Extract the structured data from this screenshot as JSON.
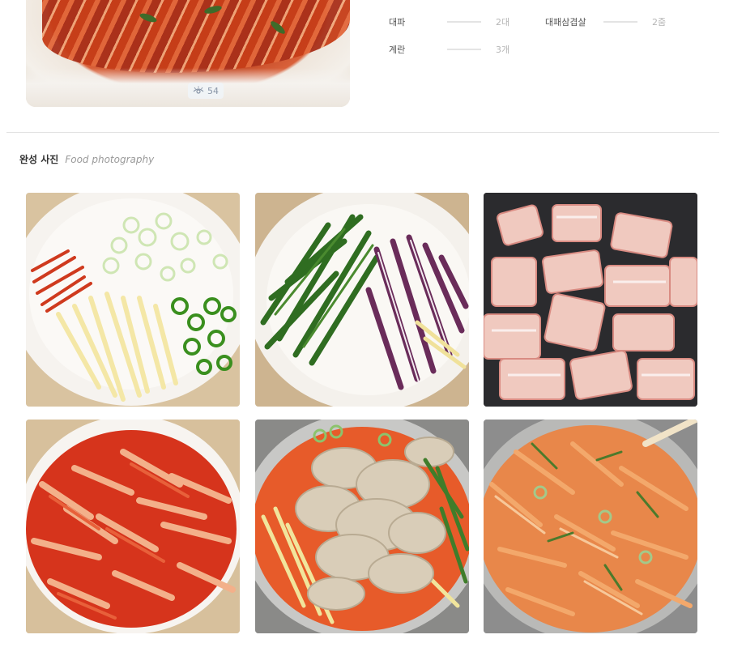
{
  "hero": {
    "views": "54",
    "icon": "eye-icon"
  },
  "ingredients": [
    {
      "name": "대파",
      "qty": "2대"
    },
    {
      "name": "대패삼겹살",
      "qty": "2줌"
    },
    {
      "name": "계란",
      "qty": "3개"
    }
  ],
  "section": {
    "title_ko": "완성 사진",
    "title_en": "Food photography"
  },
  "photos": [
    {
      "label": "sliced-vegetables"
    },
    {
      "label": "greens-and-squid"
    },
    {
      "label": "pork-belly-in-pan"
    },
    {
      "label": "seasoned-kimchi-mix"
    },
    {
      "label": "mixed-in-pot"
    },
    {
      "label": "finished-dish"
    }
  ]
}
